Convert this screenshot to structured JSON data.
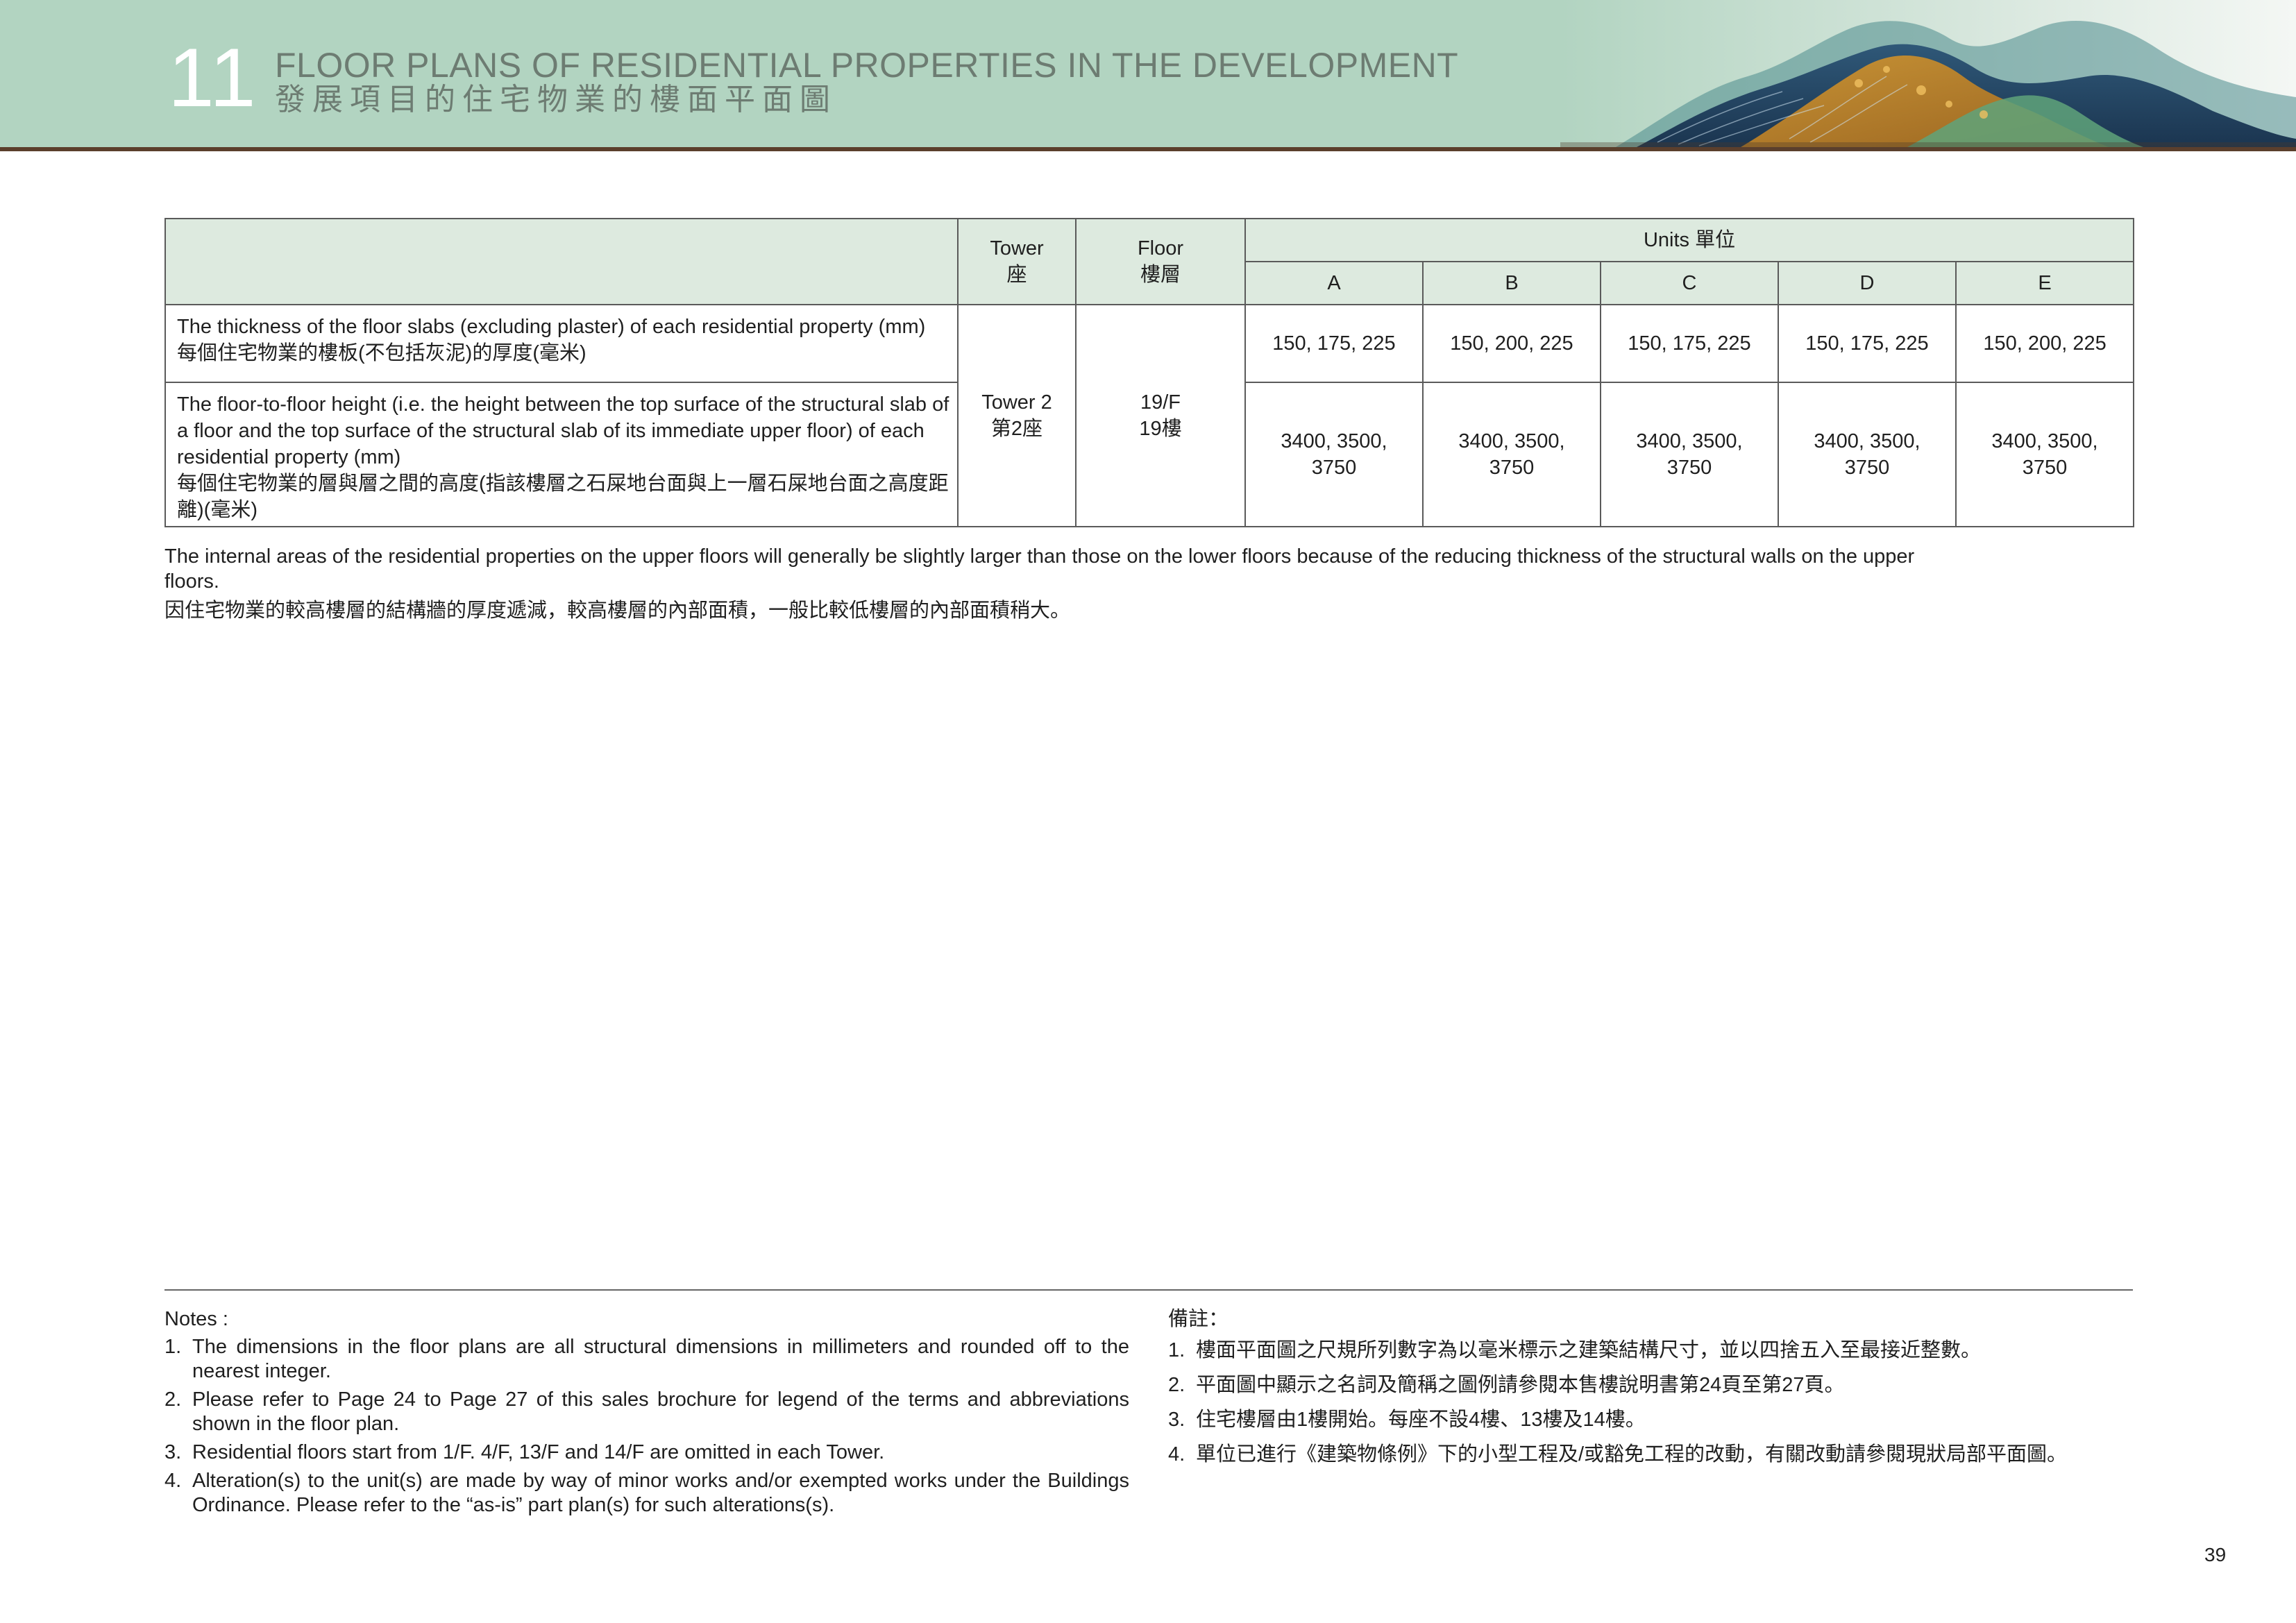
{
  "header": {
    "section_number": "11",
    "title_en": "FLOOR PLANS OF RESIDENTIAL PROPERTIES IN THE DEVELOPMENT",
    "title_zh": "發展項目的住宅物業的樓面平面圖",
    "colors": {
      "band": "#b2d4c1",
      "rule": "#5b3f2c",
      "title_text": "#6d7c72"
    }
  },
  "table": {
    "header_tower_en": "Tower",
    "header_tower_zh": "座",
    "header_floor_en": "Floor",
    "header_floor_zh": "樓層",
    "header_units": "Units 單位",
    "units": [
      "A",
      "B",
      "C",
      "D",
      "E"
    ],
    "tower_en": "Tower 2",
    "tower_zh": "第2座",
    "floor_en": "19/F",
    "floor_zh": "19樓",
    "rows": [
      {
        "desc_en": "The thickness of the floor slabs (excluding plaster) of each residential property (mm)",
        "desc_zh": "每個住宅物業的樓板(不包括灰泥)的厚度(毫米)",
        "values": [
          "150, 175, 225",
          "150, 200, 225",
          "150, 175, 225",
          "150, 175, 225",
          "150, 200, 225"
        ]
      },
      {
        "desc_en": "The floor-to-floor height (i.e. the height between the top surface of the structural slab of a floor and the top surface of the structural slab of its immediate upper floor) of each residential property (mm)",
        "desc_zh": "每個住宅物業的層與層之間的高度(指該樓層之石屎地台面與上一層石屎地台面之高度距離)(毫米)",
        "values": [
          "3400, 3500, 3750",
          "3400, 3500, 3750",
          "3400, 3500, 3750",
          "3400, 3500, 3750",
          "3400, 3500, 3750"
        ]
      }
    ]
  },
  "remark": {
    "en": "The internal areas of the residential properties on the upper floors will generally be slightly larger than those on the lower floors because of the reducing thickness of the structural walls on the upper floors.",
    "zh": "因住宅物業的較高樓層的結構牆的厚度遞減，較高樓層的內部面積，一般比較低樓層的內部面積稍大。"
  },
  "notes_en": {
    "heading": "Notes :",
    "items": [
      {
        "num": "1.",
        "text": "The dimensions in the floor plans are all structural dimensions in millimeters and rounded off to the nearest integer."
      },
      {
        "num": "2.",
        "text": "Please refer to Page 24 to Page 27 of this sales brochure for legend of the terms and abbreviations shown in the floor plan."
      },
      {
        "num": "3.",
        "text": "Residential floors start from 1/F. 4/F, 13/F and 14/F are omitted in each Tower."
      },
      {
        "num": "4.",
        "text": "Alteration(s) to the unit(s) are made by way of minor works and/or exempted works under the Buildings Ordinance. Please refer to the “as-is” part plan(s) for such alterations(s)."
      }
    ]
  },
  "notes_zh": {
    "heading": "備註：",
    "items": [
      {
        "num": "1.",
        "text": "樓面平面圖之尺規所列數字為以毫米標示之建築結構尺寸，並以四捨五入至最接近整數。"
      },
      {
        "num": "2.",
        "text": "平面圖中顯示之名詞及簡稱之圖例請參閱本售樓說明書第24頁至第27頁。"
      },
      {
        "num": "3.",
        "text": "住宅樓層由1樓開始。每座不設4樓、13樓及14樓。"
      },
      {
        "num": "4.",
        "text": "單位已進行《建築物條例》下的小型工程及/或豁免工程的改動，有關改動請參閱現狀局部平面圖。"
      }
    ]
  },
  "page_number": "39"
}
